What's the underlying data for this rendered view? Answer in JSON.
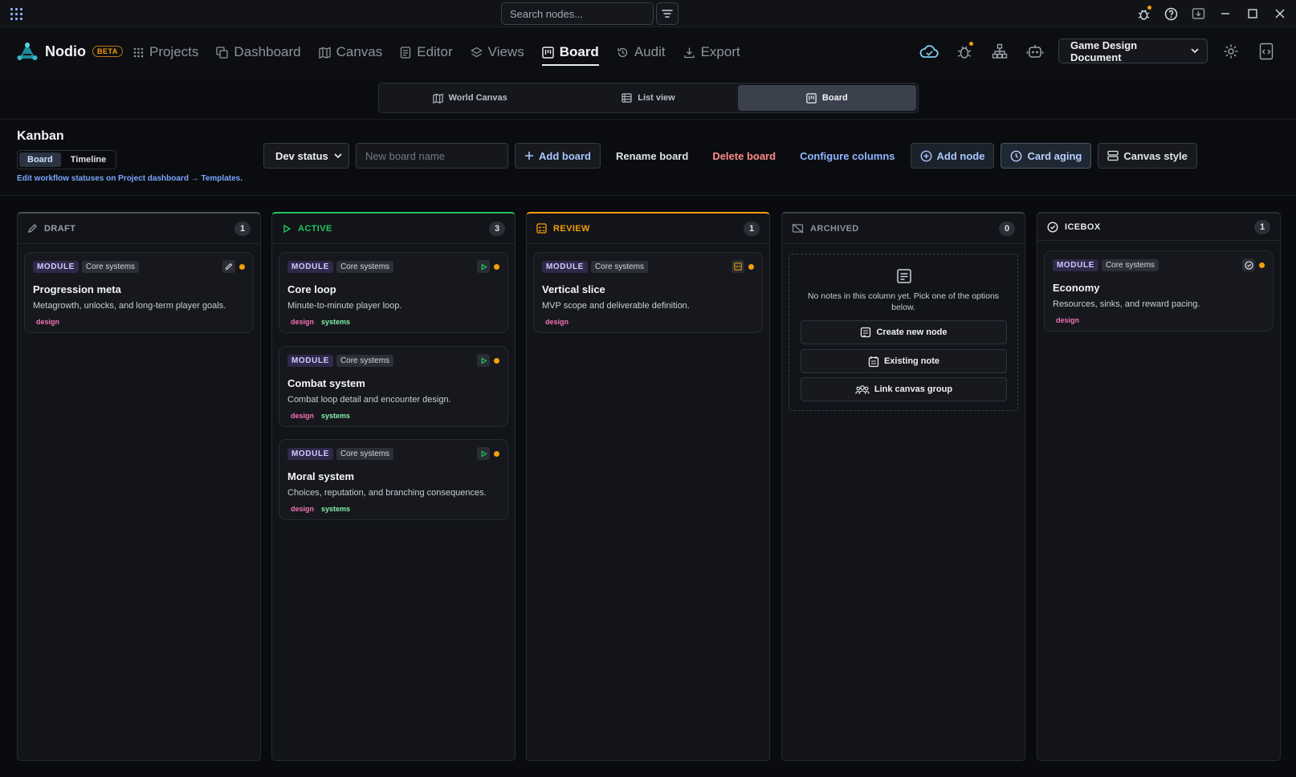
{
  "titlebar": {
    "search_placeholder": "Search nodes..."
  },
  "brand": {
    "name": "Nodio",
    "badge": "BETA"
  },
  "nav": {
    "items": [
      {
        "label": "Projects",
        "icon": "grid-icon"
      },
      {
        "label": "Dashboard",
        "icon": "copy-icon"
      },
      {
        "label": "Canvas",
        "icon": "map-icon"
      },
      {
        "label": "Editor",
        "icon": "document-icon"
      },
      {
        "label": "Views",
        "icon": "layers-icon"
      },
      {
        "label": "Board",
        "icon": "kanban-icon",
        "active": true
      },
      {
        "label": "Audit",
        "icon": "history-icon"
      },
      {
        "label": "Export",
        "icon": "download-icon"
      }
    ],
    "document_select": "Game Design Document"
  },
  "viewswitch": {
    "items": [
      {
        "label": "World Canvas"
      },
      {
        "label": "List view"
      },
      {
        "label": "Board",
        "active": true
      }
    ]
  },
  "board_header": {
    "title": "Kanban",
    "subtabs": [
      "Board",
      "Timeline"
    ],
    "hint": "Edit workflow statuses on Project dashboard → Templates.",
    "status_select": "Dev status",
    "new_board_placeholder": "New board name",
    "add_board": "Add board",
    "rename_board": "Rename board",
    "delete_board": "Delete board",
    "configure_columns": "Configure columns",
    "add_node": "Add node",
    "card_aging": "Card aging",
    "canvas_style": "Canvas style"
  },
  "colors": {
    "draft": "#9aa0aa",
    "active": "#22c55e",
    "review": "#f59e0b",
    "archived": "#8e939c",
    "icebox": "#e6e8ec",
    "status_dot": "#f59e0b"
  },
  "columns": [
    {
      "title": "DRAFT",
      "count": "1",
      "cards": [
        {
          "module": "MODULE",
          "group": "Core systems",
          "title": "Progression meta",
          "desc": "Metagrowth, unlocks, and long-term player goals.",
          "tags": [
            "design"
          ]
        }
      ]
    },
    {
      "title": "ACTIVE",
      "count": "3",
      "cards": [
        {
          "module": "MODULE",
          "group": "Core systems",
          "title": "Core loop",
          "desc": "Minute-to-minute player loop.",
          "tags": [
            "design",
            "systems"
          ]
        },
        {
          "module": "MODULE",
          "group": "Core systems",
          "title": "Combat system",
          "desc": "Combat loop detail and encounter design.",
          "tags": [
            "design",
            "systems"
          ]
        },
        {
          "module": "MODULE",
          "group": "Core systems",
          "title": "Moral system",
          "desc": "Choices, reputation, and branching consequences.",
          "tags": [
            "design",
            "systems"
          ]
        }
      ]
    },
    {
      "title": "REVIEW",
      "count": "1",
      "cards": [
        {
          "module": "MODULE",
          "group": "Core systems",
          "title": "Vertical slice",
          "desc": "MVP scope and deliverable definition.",
          "tags": [
            "design"
          ]
        }
      ]
    },
    {
      "title": "ARCHIVED",
      "count": "0",
      "empty": {
        "text": "No notes in this column yet. Pick one of the options below.",
        "create": "Create new node",
        "existing": "Existing note",
        "link": "Link canvas group"
      }
    },
    {
      "title": "ICEBOX",
      "count": "1",
      "cards": [
        {
          "module": "MODULE",
          "group": "Core systems",
          "title": "Economy",
          "desc": "Resources, sinks, and reward pacing.",
          "tags": [
            "design"
          ]
        }
      ]
    }
  ]
}
